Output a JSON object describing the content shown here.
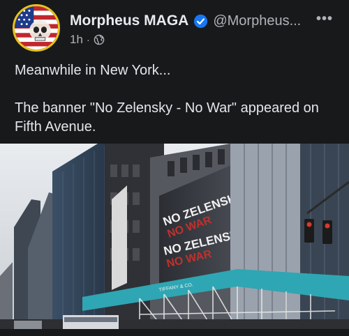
{
  "author": {
    "name": "Morpheus MAGA",
    "handle": "@Morpheus...",
    "verified": true,
    "avatar_icon": "us-flag-skull-avatar-icon"
  },
  "meta": {
    "time": "1h",
    "separator": "·",
    "audience_icon": "globe-icon"
  },
  "menu": {
    "more_label": "•••"
  },
  "post_text": {
    "line1": "Meanwhile in New York...",
    "line2": "The banner \"No Zelensky - No War\" appeared on Fifth Avenue."
  },
  "photo": {
    "banner_line_top": "NO ZELENSKY",
    "banner_line_bottom": "NO WAR",
    "store_sign": "TIFFANY & CO.",
    "colors": {
      "banner_red": "#c0312b",
      "storefront_teal": "#2fa6b3"
    }
  },
  "colors": {
    "background": "#18191b",
    "accent_verified": "#1877f2",
    "avatar_ring": "#e8c21a"
  }
}
